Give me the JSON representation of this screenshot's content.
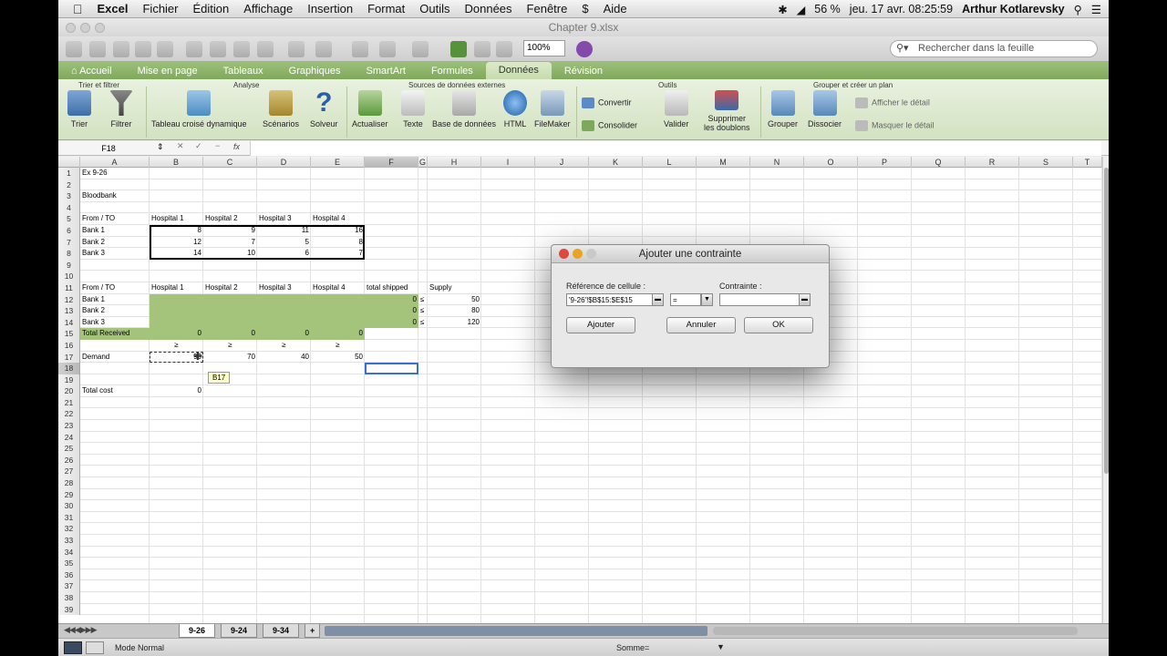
{
  "menubar": {
    "apple": "",
    "app_name": "Excel",
    "items": [
      "Fichier",
      "Édition",
      "Affichage",
      "Insertion",
      "Format",
      "Outils",
      "Données",
      "Fenêtre",
      "$",
      "Aide"
    ],
    "battery": "56 %",
    "datetime": "jeu. 17 avr.  08:25:59",
    "user": "Arthur Kotlarevsky"
  },
  "window": {
    "title": "Chapter 9.xlsx",
    "zoom": "100%",
    "search_placeholder": "Rechercher dans la feuille"
  },
  "ribbon": {
    "tabs": [
      "Accueil",
      "Mise en page",
      "Tableaux",
      "Graphiques",
      "SmartArt",
      "Formules",
      "Données",
      "Révision"
    ],
    "active_tab": "Données",
    "groups": [
      "Trier et filtrer",
      "Analyse",
      "Sources de données externes",
      "Outils",
      "Grouper et créer un plan"
    ],
    "buttons": {
      "trier": "Trier",
      "filtrer": "Filtrer",
      "tcd": "Tableau croisé dynamique",
      "scenarios": "Scénarios",
      "solveur": "Solveur",
      "actualiser": "Actualiser",
      "texte": "Texte",
      "bdd": "Base de données",
      "html": "HTML",
      "filemaker": "FileMaker",
      "convertir": "Convertir",
      "consolider": "Consolider",
      "valider": "Valider",
      "supprimer_1": "Supprimer",
      "supprimer_2": "les doublons",
      "grouper": "Grouper",
      "dissocier": "Dissocier",
      "afficher": "Afficher le détail",
      "masquer": "Masquer le détail"
    }
  },
  "formula_bar": {
    "name_box": "F18",
    "fx": "fx",
    "value": ""
  },
  "sheet": {
    "columns": [
      "A",
      "B",
      "C",
      "D",
      "E",
      "F",
      "G",
      "H",
      "I",
      "J",
      "K",
      "L",
      "M",
      "N",
      "O",
      "P",
      "Q",
      "R",
      "S",
      "T"
    ],
    "row_numbers": [
      "1",
      "2",
      "3",
      "4",
      "5",
      "6",
      "7",
      "8",
      "9",
      "10",
      "11",
      "12",
      "13",
      "14",
      "15",
      "16",
      "17",
      "18",
      "19",
      "20",
      "21",
      "22",
      "23",
      "24",
      "25",
      "26",
      "27",
      "28",
      "29",
      "30",
      "31",
      "32",
      "33",
      "34",
      "35",
      "36",
      "37",
      "38",
      "39"
    ],
    "cells": {
      "a1": "Ex 9-26",
      "a3": "Bloodbank",
      "a5": "From / TO",
      "hdr1": [
        "Hospital 1",
        "Hospital 2",
        "Hospital 3",
        "Hospital 4"
      ],
      "a6": "Bank 1",
      "a7": "Bank 2",
      "a8": "Bank 3",
      "r6": [
        "8",
        "9",
        "11",
        "16"
      ],
      "r7": [
        "12",
        "7",
        "5",
        "8"
      ],
      "r8": [
        "14",
        "10",
        "6",
        "7"
      ],
      "a11": "From / TO",
      "hdr2": [
        "Hospital 1",
        "Hospital 2",
        "Hospital 3",
        "Hospital 4"
      ],
      "f11": "total shipped",
      "h11": "Supply",
      "a12": "Bank 1",
      "a13": "Bank 2",
      "a14": "Bank 3",
      "shipped": [
        "0",
        "0",
        "0"
      ],
      "le": "≤",
      "supply": [
        "50",
        "80",
        "120"
      ],
      "a15": "Total Received",
      "received": [
        "0",
        "0",
        "0",
        "0"
      ],
      "ge": "≥",
      "a17": "Demand",
      "demand": [
        "90",
        "70",
        "40",
        "50"
      ],
      "a20": "Total cost",
      "b20": "0",
      "tooltip": "B17"
    }
  },
  "sheet_tabs": [
    "9-26",
    "9-24",
    "9-34",
    "+"
  ],
  "status": {
    "mode": "Mode Normal",
    "sum": "Somme="
  },
  "dialog": {
    "title": "Ajouter une contrainte",
    "cell_ref_label": "Référence de cellule :",
    "cell_ref_value": "'9-26'!$B$15:$E$15",
    "operator": "=",
    "constraint_label": "Contrainte :",
    "constraint_value": "",
    "btn_add": "Ajouter",
    "btn_cancel": "Annuler",
    "btn_ok": "OK"
  }
}
